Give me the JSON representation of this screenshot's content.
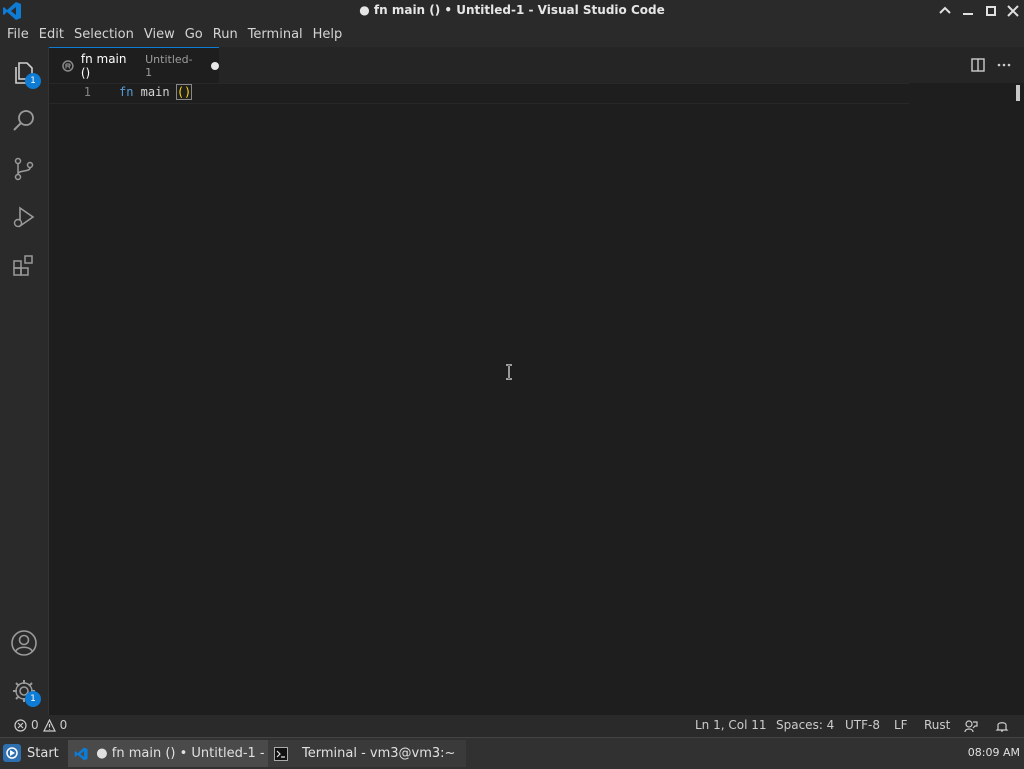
{
  "window": {
    "title": "● fn main () • Untitled-1 - Visual Studio Code"
  },
  "menu": [
    "File",
    "Edit",
    "Selection",
    "View",
    "Go",
    "Run",
    "Terminal",
    "Help"
  ],
  "activity_bar": {
    "explorer_badge": "1",
    "manage_badge": "1"
  },
  "tab": {
    "title": "fn main ()",
    "description": "Untitled-1"
  },
  "editor": {
    "line_number": "1",
    "code": {
      "keyword": "fn",
      "name": " main ",
      "parens": "()"
    }
  },
  "statusbar": {
    "errors": "0",
    "warnings": "0",
    "position": "Ln 1, Col 11",
    "spaces": "Spaces: 4",
    "encoding": "UTF-8",
    "eol": "LF",
    "language": "Rust"
  },
  "taskbar": {
    "start_label": "Start",
    "tasks": [
      {
        "label": "● fn main () • Untitled-1 - V..."
      },
      {
        "label": "Terminal - vm3@vm3:~"
      }
    ],
    "clock": "08:09 AM"
  },
  "colors": {
    "accent": "#0e7bd4",
    "keyword": "#569cd6",
    "bracket": "#ffd700"
  }
}
